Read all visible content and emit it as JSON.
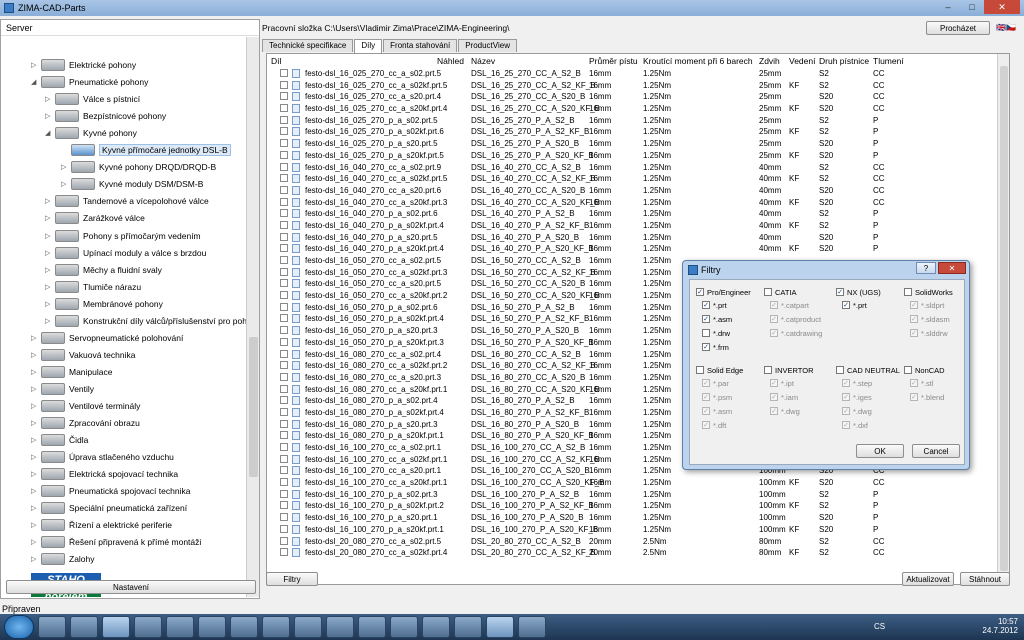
{
  "window": {
    "title": "ZIMA-CAD-Parts",
    "min": "–",
    "max": "□",
    "close": "✕"
  },
  "left": {
    "header": "Server",
    "tree": [
      {
        "label": "Elektrické pohony",
        "depth": 1,
        "exp": "▷",
        "icon": "motor-icon"
      },
      {
        "label": "Pneumatické pohony",
        "depth": 1,
        "exp": "◢",
        "icon": "pneumatic-icon"
      },
      {
        "label": "Válce s pístnicí",
        "depth": 2,
        "exp": "▷",
        "icon": "cylinder-icon"
      },
      {
        "label": "Bezpístnicové pohony",
        "depth": 2,
        "exp": "▷",
        "icon": "rodless-icon"
      },
      {
        "label": "Kyvné pohony",
        "depth": 2,
        "exp": "◢",
        "icon": "swivel-icon"
      },
      {
        "label": "Kyvné přímočaré jednotky DSL-B",
        "depth": 3,
        "exp": "",
        "icon": "dsl-icon",
        "selected": true
      },
      {
        "label": "Kyvné pohony DRQD/DRQD-B",
        "depth": 3,
        "exp": "▷",
        "icon": "drqd-icon"
      },
      {
        "label": "Kyvné moduly DSM/DSM-B",
        "depth": 3,
        "exp": "▷",
        "icon": "dsm-icon"
      },
      {
        "label": "Tandemové a vícepolohové válce",
        "depth": 2,
        "exp": "▷",
        "icon": "tandem-icon"
      },
      {
        "label": "Zarážkové válce",
        "depth": 2,
        "exp": "▷",
        "icon": "stopper-icon"
      },
      {
        "label": "Pohony s přímočarým vedením",
        "depth": 2,
        "exp": "▷",
        "icon": "guided-icon"
      },
      {
        "label": "Upínací moduly a válce s brzdou",
        "depth": 2,
        "exp": "▷",
        "icon": "clamp-icon"
      },
      {
        "label": "Měchy a fluidní svaly",
        "depth": 2,
        "exp": "▷",
        "icon": "bellows-icon"
      },
      {
        "label": "Tlumiče nárazu",
        "depth": 2,
        "exp": "▷",
        "icon": "shock-icon"
      },
      {
        "label": "Membránové pohony",
        "depth": 2,
        "exp": "▷",
        "icon": "membrane-icon"
      },
      {
        "label": "Konstrukční díly válců/příslušenství pro pohony",
        "depth": 2,
        "exp": "▷",
        "icon": "accessory-icon"
      },
      {
        "label": "Servopneumatické polohování",
        "depth": 1,
        "exp": "▷",
        "icon": "servo-icon"
      },
      {
        "label": "Vakuová technika",
        "depth": 1,
        "exp": "▷",
        "icon": "vacuum-icon"
      },
      {
        "label": "Manipulace",
        "depth": 1,
        "exp": "▷",
        "icon": "handling-icon"
      },
      {
        "label": "Ventily",
        "depth": 1,
        "exp": "▷",
        "icon": "valve-icon"
      },
      {
        "label": "Ventilové terminály",
        "depth": 1,
        "exp": "▷",
        "icon": "terminal-icon"
      },
      {
        "label": "Zpracování obrazu",
        "depth": 1,
        "exp": "▷",
        "icon": "camera-icon"
      },
      {
        "label": "Čidla",
        "depth": 1,
        "exp": "▷",
        "icon": "sensor-icon"
      },
      {
        "label": "Úprava stlačeného vzduchu",
        "depth": 1,
        "exp": "▷",
        "icon": "air-icon"
      },
      {
        "label": "Elektrická spojovací technika",
        "depth": 1,
        "exp": "▷",
        "icon": "connector-icon"
      },
      {
        "label": "Pneumatická spojovací technika",
        "depth": 1,
        "exp": "▷",
        "icon": "fitting-icon"
      },
      {
        "label": "Speciální pneumatická zařízení",
        "depth": 1,
        "exp": "▷",
        "icon": "special-icon"
      },
      {
        "label": "Řízení a elektrické periferie",
        "depth": 1,
        "exp": "▷",
        "icon": "control-icon"
      },
      {
        "label": "Řešení připravená k přímé montáži",
        "depth": 1,
        "exp": "▷",
        "icon": "solution-icon"
      },
      {
        "label": "Zalohy",
        "depth": 1,
        "exp": "▷",
        "icon": "folder-icon"
      }
    ],
    "logos": [
      {
        "text": "STAHO",
        "color": "#1b5db0"
      },
      {
        "text": "norelem",
        "color": "#0a7a3a"
      }
    ],
    "settings_button": "Nastavení"
  },
  "status": "Připraven",
  "main": {
    "folder_label": "Pracovní složka C:\\Users\\Vladimir Zima\\Prace\\ZIMA-Engineering\\",
    "browse_button": "Procházet",
    "tabs": [
      "Technické specifikace",
      "Díly",
      "Fronta stahování",
      "ProductView"
    ],
    "active_tab": 1,
    "columns": [
      "Díl",
      "Náhled",
      "Název",
      "Průměr pístu",
      "Kroutící moment při 6 barech",
      "Zdvih",
      "Vedení",
      "Druh pístnice",
      "Tlumení"
    ],
    "rows": [
      [
        "festo-dsl_16_025_270_cc_a_s02.prt.5",
        "",
        "DSL_16_25_270_CC_A_S2_B",
        "16mm",
        "1.25Nm",
        "25mm",
        "",
        "S2",
        "CC"
      ],
      [
        "festo-dsl_16_025_270_cc_a_s02kf.prt.5",
        "",
        "DSL_16_25_270_CC_A_S2_KF_B",
        "16mm",
        "1.25Nm",
        "25mm",
        "KF",
        "S2",
        "CC"
      ],
      [
        "festo-dsl_16_025_270_cc_a_s20.prt.4",
        "",
        "DSL_16_25_270_CC_A_S20_B",
        "16mm",
        "1.25Nm",
        "25mm",
        "",
        "S20",
        "CC"
      ],
      [
        "festo-dsl_16_025_270_cc_a_s20kf.prt.4",
        "",
        "DSL_16_25_270_CC_A_S20_KF_B",
        "16mm",
        "1.25Nm",
        "25mm",
        "KF",
        "S20",
        "CC"
      ],
      [
        "festo-dsl_16_025_270_p_a_s02.prt.5",
        "",
        "DSL_16_25_270_P_A_S2_B",
        "16mm",
        "1.25Nm",
        "25mm",
        "",
        "S2",
        "P"
      ],
      [
        "festo-dsl_16_025_270_p_a_s02kf.prt.6",
        "",
        "DSL_16_25_270_P_A_S2_KF_B",
        "16mm",
        "1.25Nm",
        "25mm",
        "KF",
        "S2",
        "P"
      ],
      [
        "festo-dsl_16_025_270_p_a_s20.prt.5",
        "",
        "DSL_16_25_270_P_A_S20_B",
        "16mm",
        "1.25Nm",
        "25mm",
        "",
        "S20",
        "P"
      ],
      [
        "festo-dsl_16_025_270_p_a_s20kf.prt.5",
        "",
        "DSL_16_25_270_P_A_S20_KF_B",
        "16mm",
        "1.25Nm",
        "25mm",
        "KF",
        "S20",
        "P"
      ],
      [
        "festo-dsl_16_040_270_cc_a_s02.prt.9",
        "",
        "DSL_16_40_270_CC_A_S2_B",
        "16mm",
        "1.25Nm",
        "40mm",
        "",
        "S2",
        "CC"
      ],
      [
        "festo-dsl_16_040_270_cc_a_s02kf.prt.5",
        "",
        "DSL_16_40_270_CC_A_S2_KF_B",
        "16mm",
        "1.25Nm",
        "40mm",
        "KF",
        "S2",
        "CC"
      ],
      [
        "festo-dsl_16_040_270_cc_a_s20.prt.6",
        "",
        "DSL_16_40_270_CC_A_S20_B",
        "16mm",
        "1.25Nm",
        "40mm",
        "",
        "S20",
        "CC"
      ],
      [
        "festo-dsl_16_040_270_cc_a_s20kf.prt.3",
        "",
        "DSL_16_40_270_CC_A_S20_KF_B",
        "16mm",
        "1.25Nm",
        "40mm",
        "KF",
        "S20",
        "CC"
      ],
      [
        "festo-dsl_16_040_270_p_a_s02.prt.6",
        "",
        "DSL_16_40_270_P_A_S2_B",
        "16mm",
        "1.25Nm",
        "40mm",
        "",
        "S2",
        "P"
      ],
      [
        "festo-dsl_16_040_270_p_a_s02kf.prt.4",
        "",
        "DSL_16_40_270_P_A_S2_KF_B",
        "16mm",
        "1.25Nm",
        "40mm",
        "KF",
        "S2",
        "P"
      ],
      [
        "festo-dsl_16_040_270_p_a_s20.prt.5",
        "",
        "DSL_16_40_270_P_A_S20_B",
        "16mm",
        "1.25Nm",
        "40mm",
        "",
        "S20",
        "P"
      ],
      [
        "festo-dsl_16_040_270_p_a_s20kf.prt.4",
        "",
        "DSL_16_40_270_P_A_S20_KF_B",
        "16mm",
        "1.25Nm",
        "40mm",
        "KF",
        "S20",
        "P"
      ],
      [
        "festo-dsl_16_050_270_cc_a_s02.prt.5",
        "",
        "DSL_16_50_270_CC_A_S2_B",
        "16mm",
        "1.25Nm",
        "",
        "",
        "",
        ""
      ],
      [
        "festo-dsl_16_050_270_cc_a_s02kf.prt.3",
        "",
        "DSL_16_50_270_CC_A_S2_KF_B",
        "16mm",
        "1.25Nm",
        "",
        "",
        "",
        ""
      ],
      [
        "festo-dsl_16_050_270_cc_a_s20.prt.5",
        "",
        "DSL_16_50_270_CC_A_S20_B",
        "16mm",
        "1.25Nm",
        "",
        "",
        "",
        ""
      ],
      [
        "festo-dsl_16_050_270_cc_a_s20kf.prt.2",
        "",
        "DSL_16_50_270_CC_A_S20_KF_B",
        "16mm",
        "1.25Nm",
        "",
        "",
        "",
        ""
      ],
      [
        "festo-dsl_16_050_270_p_a_s02.prt.6",
        "",
        "DSL_16_50_270_P_A_S2_B",
        "16mm",
        "1.25Nm",
        "",
        "",
        "",
        ""
      ],
      [
        "festo-dsl_16_050_270_p_a_s02kf.prt.4",
        "",
        "DSL_16_50_270_P_A_S2_KF_B",
        "16mm",
        "1.25Nm",
        "",
        "",
        "",
        ""
      ],
      [
        "festo-dsl_16_050_270_p_a_s20.prt.3",
        "",
        "DSL_16_50_270_P_A_S20_B",
        "16mm",
        "1.25Nm",
        "",
        "",
        "",
        ""
      ],
      [
        "festo-dsl_16_050_270_p_a_s20kf.prt.3",
        "",
        "DSL_16_50_270_P_A_S20_KF_B",
        "16mm",
        "1.25Nm",
        "",
        "",
        "",
        ""
      ],
      [
        "festo-dsl_16_080_270_cc_a_s02.prt.4",
        "",
        "DSL_16_80_270_CC_A_S2_B",
        "16mm",
        "1.25Nm",
        "",
        "",
        "",
        ""
      ],
      [
        "festo-dsl_16_080_270_cc_a_s02kf.prt.2",
        "",
        "DSL_16_80_270_CC_A_S2_KF_B",
        "16mm",
        "1.25Nm",
        "",
        "",
        "",
        ""
      ],
      [
        "festo-dsl_16_080_270_cc_a_s20.prt.3",
        "",
        "DSL_16_80_270_CC_A_S20_B",
        "16mm",
        "1.25Nm",
        "",
        "",
        "",
        ""
      ],
      [
        "festo-dsl_16_080_270_cc_a_s20kf.prt.1",
        "",
        "DSL_16_80_270_CC_A_S20_KF_B",
        "16mm",
        "1.25Nm",
        "",
        "",
        "",
        ""
      ],
      [
        "festo-dsl_16_080_270_p_a_s02.prt.4",
        "",
        "DSL_16_80_270_P_A_S2_B",
        "16mm",
        "1.25Nm",
        "",
        "",
        "",
        ""
      ],
      [
        "festo-dsl_16_080_270_p_a_s02kf.prt.4",
        "",
        "DSL_16_80_270_P_A_S2_KF_B",
        "16mm",
        "1.25Nm",
        "",
        "",
        "",
        ""
      ],
      [
        "festo-dsl_16_080_270_p_a_s20.prt.3",
        "",
        "DSL_16_80_270_P_A_S20_B",
        "16mm",
        "1.25Nm",
        "",
        "",
        "",
        ""
      ],
      [
        "festo-dsl_16_080_270_p_a_s20kf.prt.1",
        "",
        "DSL_16_80_270_P_A_S20_KF_B",
        "16mm",
        "1.25Nm",
        "",
        "",
        "",
        ""
      ],
      [
        "festo-dsl_16_100_270_cc_a_s02.prt.1",
        "",
        "DSL_16_100_270_CC_A_S2_B",
        "16mm",
        "1.25Nm",
        "",
        "",
        "",
        ""
      ],
      [
        "festo-dsl_16_100_270_cc_a_s02kf.prt.1",
        "",
        "DSL_16_100_270_CC_A_S2_KF_B",
        "16mm",
        "1.25Nm",
        "",
        "",
        "",
        ""
      ],
      [
        "festo-dsl_16_100_270_cc_a_s20.prt.1",
        "",
        "DSL_16_100_270_CC_A_S20_B",
        "16mm",
        "1.25Nm",
        "100mm",
        "",
        "S20",
        "CC"
      ],
      [
        "festo-dsl_16_100_270_cc_a_s20kf.prt.1",
        "",
        "DSL_16_100_270_CC_A_S20_KF_B",
        "16mm",
        "1.25Nm",
        "100mm",
        "KF",
        "S20",
        "CC"
      ],
      [
        "festo-dsl_16_100_270_p_a_s02.prt.3",
        "",
        "DSL_16_100_270_P_A_S2_B",
        "16mm",
        "1.25Nm",
        "100mm",
        "",
        "S2",
        "P"
      ],
      [
        "festo-dsl_16_100_270_p_a_s02kf.prt.2",
        "",
        "DSL_16_100_270_P_A_S2_KF_B",
        "16mm",
        "1.25Nm",
        "100mm",
        "KF",
        "S2",
        "P"
      ],
      [
        "festo-dsl_16_100_270_p_a_s20.prt.1",
        "",
        "DSL_16_100_270_P_A_S20_B",
        "16mm",
        "1.25Nm",
        "100mm",
        "",
        "S20",
        "P"
      ],
      [
        "festo-dsl_16_100_270_p_a_s20kf.prt.1",
        "",
        "DSL_16_100_270_P_A_S20_KF_B",
        "16mm",
        "1.25Nm",
        "100mm",
        "KF",
        "S20",
        "P"
      ],
      [
        "festo-dsl_20_080_270_cc_a_s02.prt.5",
        "",
        "DSL_20_80_270_CC_A_S2_B",
        "20mm",
        "2.5Nm",
        "80mm",
        "",
        "S2",
        "CC"
      ],
      [
        "festo-dsl_20_080_270_cc_a_s02kf.prt.4",
        "",
        "DSL_20_80_270_CC_A_S2_KF_B",
        "20mm",
        "2.5Nm",
        "80mm",
        "KF",
        "S2",
        "CC"
      ]
    ],
    "filters_button": "Filtry",
    "update_button": "Aktualizovat",
    "download_button": "Stáhnout"
  },
  "dialog": {
    "title": "Filtry",
    "help": "?",
    "close": "✕",
    "groups": [
      {
        "name": "Pro/Engineer",
        "checked": true,
        "items": [
          {
            "label": "*.prt",
            "checked": true
          },
          {
            "label": "*.asm",
            "checked": true
          },
          {
            "label": "*.drw",
            "checked": false
          },
          {
            "label": "*.frm",
            "checked": true
          }
        ]
      },
      {
        "name": "CATIA",
        "checked": false,
        "items": [
          {
            "label": "*.catpart",
            "checked": true
          },
          {
            "label": "*.catproduct",
            "checked": true
          },
          {
            "label": "*.catdrawing",
            "checked": true
          }
        ]
      },
      {
        "name": "NX (UGS)",
        "checked": true,
        "items": [
          {
            "label": "*.prt",
            "checked": true
          }
        ]
      },
      {
        "name": "SolidWorks",
        "checked": false,
        "items": [
          {
            "label": "*.sldprt",
            "checked": true
          },
          {
            "label": "*.sldasm",
            "checked": true
          },
          {
            "label": "*.slddrw",
            "checked": true
          }
        ]
      },
      {
        "name": "Solid Edge",
        "checked": false,
        "items": [
          {
            "label": "*.par",
            "checked": true
          },
          {
            "label": "*.psm",
            "checked": true
          },
          {
            "label": "*.asm",
            "checked": true
          },
          {
            "label": "*.dft",
            "checked": true
          }
        ]
      },
      {
        "name": "INVERTOR",
        "checked": false,
        "items": [
          {
            "label": "*.ipt",
            "checked": true
          },
          {
            "label": "*.iam",
            "checked": true
          },
          {
            "label": "*.dwg",
            "checked": true
          }
        ]
      },
      {
        "name": "CAD NEUTRAL",
        "checked": false,
        "items": [
          {
            "label": "*.step",
            "checked": true
          },
          {
            "label": "*.iges",
            "checked": true
          },
          {
            "label": "*.dwg",
            "checked": true
          },
          {
            "label": "*.dxf",
            "checked": true
          }
        ]
      },
      {
        "name": "NonCAD",
        "checked": false,
        "items": [
          {
            "label": "*.stl",
            "checked": true
          },
          {
            "label": "*.blend",
            "checked": true
          }
        ]
      }
    ],
    "ok": "OK",
    "cancel": "Cancel"
  },
  "taskbar": {
    "lang": "CS",
    "time": "10:57",
    "date": "24.7.2012",
    "icons": [
      "opera-icon",
      "app-icon",
      "hp-icon",
      "settings-icon",
      "folder-icon",
      "save-icon",
      "terminal-icon",
      "chart-icon",
      "network-icon",
      "notes-icon",
      "tools-icon",
      "calculator-icon",
      "editor-icon",
      "media-icon",
      "cad-icon",
      "chrome-icon"
    ]
  }
}
